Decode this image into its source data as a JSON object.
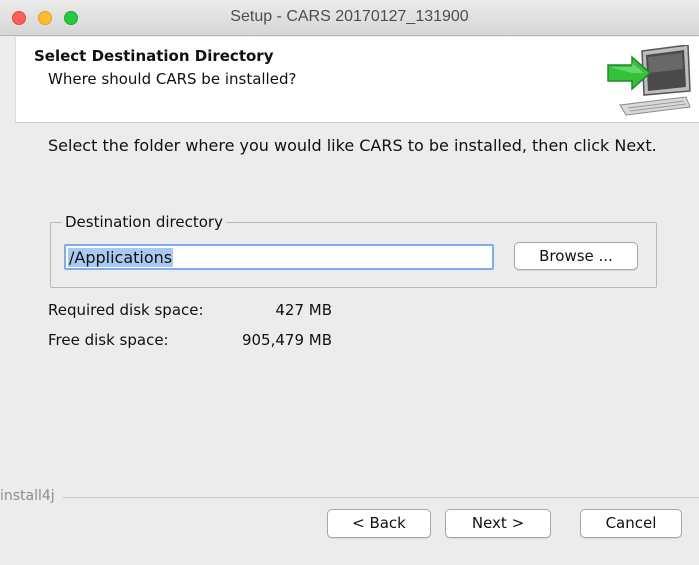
{
  "window": {
    "title": "Setup - CARS 20170127_131900"
  },
  "header": {
    "title": "Select Destination Directory",
    "subtitle": "Where should CARS be installed?",
    "icon": "install-computer-icon"
  },
  "main": {
    "description": "Select the folder where you would like CARS to be installed, then click Next.",
    "destination_group_label": "Destination directory",
    "destination_value": "/Applications",
    "browse_label": "Browse ...",
    "required_label": "Required disk space:",
    "required_value": "427 MB",
    "free_label": "Free disk space:",
    "free_value": "905,479 MB"
  },
  "footer": {
    "brand": "install4j",
    "back_label": "< Back",
    "next_label": "Next >",
    "cancel_label": "Cancel"
  },
  "colors": {
    "close": "#fc5f57",
    "minimize": "#fdbc2e",
    "maximize": "#28c840",
    "selection": "#a9c9f2",
    "focus_ring": "#7aaef0"
  }
}
